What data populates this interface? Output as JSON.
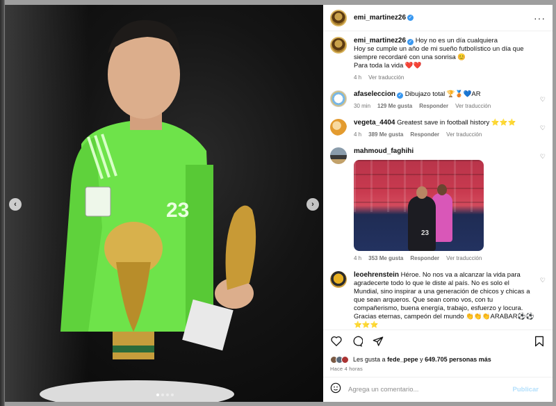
{
  "media": {
    "prev_icon": "chevron-left-icon",
    "next_icon": "chevron-right-icon",
    "prev_glyph": "‹",
    "next_glyph": "›",
    "carousel_dots": 4,
    "active_dot": 1,
    "jersey_number": "23"
  },
  "header": {
    "username": "emi_martinez26",
    "verified": true,
    "more_glyph": "···"
  },
  "caption": {
    "username": "emi_martinez26",
    "text_line1": "Hoy no es un día cualquiera",
    "text_line2": "Hoy se cumple un año de mi sueño futbolístico un día que siempre recordaré con una sonrisa 😊",
    "text_line3": "Para toda la vida ❤️❤️",
    "time": "4 h",
    "translate": "Ver traducción"
  },
  "comments": [
    {
      "username": "afaseleccion",
      "verified": true,
      "text": "Dibujazo total 🏆🥉💙AR",
      "time": "30 min",
      "likes": "129 Me gusta",
      "reply": "Responder",
      "translate": "Ver traducción"
    },
    {
      "username": "vegeta_4404",
      "text": "Greatest save in football history ⭐⭐⭐",
      "time": "4 h",
      "likes": "389 Me gusta",
      "reply": "Responder",
      "translate": "Ver traducción"
    },
    {
      "username": "mahmoud_faghihi",
      "text": "",
      "time": "4 h",
      "likes": "353 Me gusta",
      "reply": "Responder",
      "translate": "Ver traducción",
      "image_number": "23"
    },
    {
      "username": "leoehrenstein",
      "text": "Héroe. No nos va a alcanzar la vida para agradecerte todo lo que le diste al país. No es solo el Mundial, sino inspirar a una generación de chicos y chicas a que sean arqueros. Que sean como vos, con tu compañerismo, buena energía, trabajo, esfuerzo y locura. Gracias eternas, campeón del mundo 👏👏👏ARABAR⚽⚽⭐⭐⭐"
    }
  ],
  "actions": {
    "like_icon": "heart-icon",
    "comment_icon": "comment-icon",
    "share_icon": "share-icon",
    "save_icon": "bookmark-icon"
  },
  "likes": {
    "prefix": "Les gusta a",
    "user": "fede_pepe",
    "middle": "y",
    "count": "649.705",
    "suffix": "personas más"
  },
  "time_ago": "Hace 4 horas",
  "add_comment": {
    "emoji_icon": "emoji-icon",
    "placeholder": "Agrega un comentario...",
    "post_label": "Publicar"
  },
  "colors": {
    "verified": "#3897f0",
    "post_disabled": "#b2dffc",
    "jersey": "#6ee34a"
  }
}
